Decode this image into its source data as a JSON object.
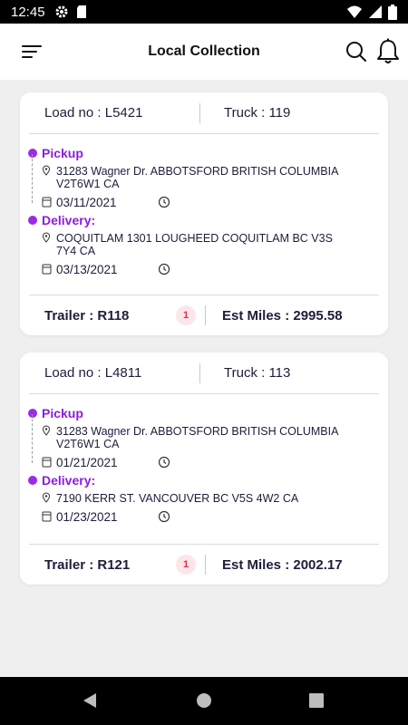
{
  "status_bar": {
    "time": "12:45"
  },
  "header": {
    "title": "Local Collection"
  },
  "loads": [
    {
      "load_no": "Load no : L5421",
      "truck": "Truck : 119",
      "pickup": {
        "label": "Pickup",
        "address": "31283 Wagner Dr.  ABBOTSFORD  BRITISH COLUMBIA  V2T6W1  CA",
        "date": "03/11/2021"
      },
      "delivery": {
        "label": "Delivery:",
        "address": "COQUITLAM 1301 LOUGHEED  COQUITLAM   BC   V3S 7Y4  CA",
        "date": "03/13/2021"
      },
      "trailer": "Trailer : R118",
      "badge": "1",
      "est_miles": "Est Miles : 2995.58"
    },
    {
      "load_no": "Load no : L4811",
      "truck": "Truck : 113",
      "pickup": {
        "label": "Pickup",
        "address": "31283 Wagner Dr.  ABBOTSFORD  BRITISH COLUMBIA  V2T6W1  CA",
        "date": "01/21/2021"
      },
      "delivery": {
        "label": "Delivery:",
        "address": "7190 KERR ST.  VANCOUVER   BC   V5S 4W2  CA",
        "date": "01/23/2021"
      },
      "trailer": "Trailer : R121",
      "badge": "1",
      "est_miles": "Est Miles : 2002.17"
    }
  ],
  "colors": {
    "accent": "#8c1ce0",
    "badge_bg": "#fde6ea",
    "badge_text": "#e22c48"
  }
}
